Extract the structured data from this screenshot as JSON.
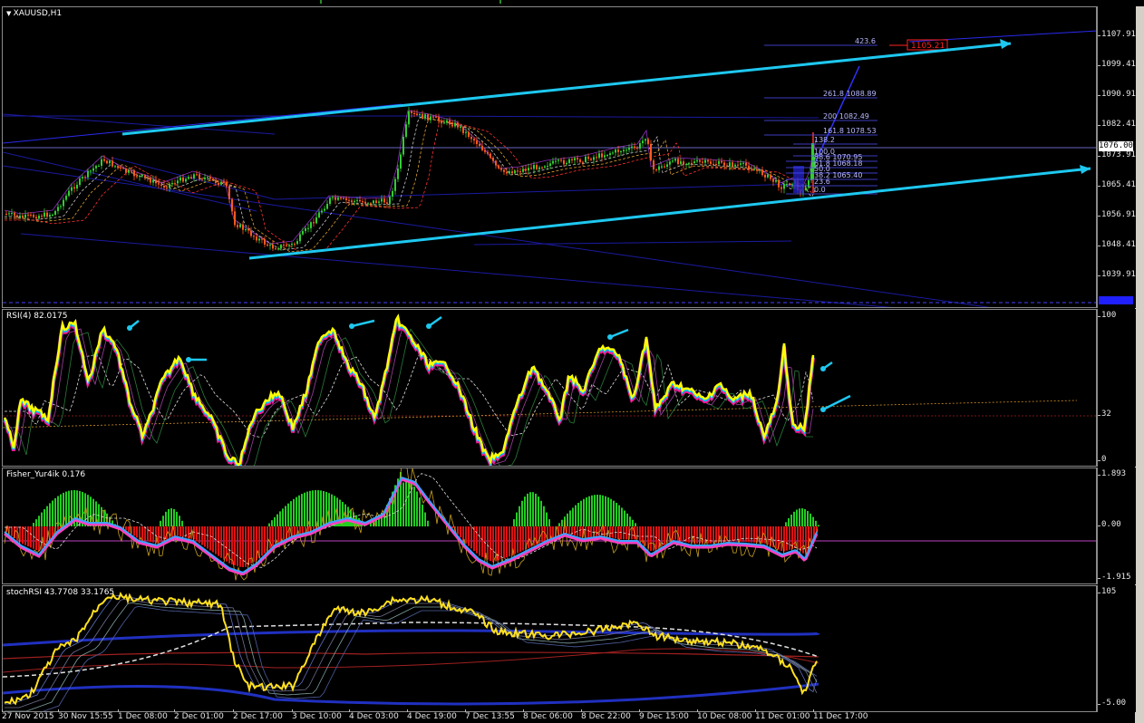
{
  "window": {
    "title": "XAUUSD,H1"
  },
  "main_chart": {
    "symbol_label": "XAUUSD,H1",
    "price_ticks": [
      "1107.91",
      "1099.41",
      "1090.91",
      "1082.41",
      "1073.91",
      "1065.41",
      "1056.91",
      "1048.41",
      "1039.91"
    ],
    "current_price": "1076.00",
    "target_label": "1105.21",
    "fib_levels": [
      "423.6",
      "261.8 1088.89",
      "200 1082.49",
      "161.8 1078.53",
      "138.2",
      "100.0",
      "88.6 1070.95",
      "61.8 1068.18",
      "50.0",
      "38.2 1065.40",
      "23.6",
      "0.0"
    ]
  },
  "rsi_panel": {
    "label": "RSI(4) 82.0175",
    "ticks": [
      "100",
      "32",
      "0"
    ]
  },
  "fisher_panel": {
    "label": "Fisher_Yur4ik 0.176",
    "ticks": [
      "1.893",
      "0.00",
      "-1.915"
    ]
  },
  "stoch_panel": {
    "label": "stochRSI 43.7708 33.1765",
    "ticks": [
      "105",
      "-5.00"
    ]
  },
  "time_axis": [
    "27 Nov 2015",
    "30 Nov 15:55",
    "1 Dec 08:00",
    "2 Dec 01:00",
    "2 Dec 17:00",
    "3 Dec 10:00",
    "4 Dec 03:00",
    "4 Dec 19:00",
    "7 Dec 13:55",
    "8 Dec 06:00",
    "8 Dec 22:00",
    "9 Dec 15:00",
    "10 Dec 08:00",
    "11 Dec 01:00",
    "11 Dec 17:00"
  ],
  "colors": {
    "bull_candle": "#32cd32",
    "bear_candle": "#ff5a1e",
    "channel_line": "#1ec8f0",
    "grid_line": "#1a1aa0",
    "rsi_yellow": "#ffff00",
    "rsi_magenta": "#ff1493",
    "rsi_cyan": "#00bfff",
    "hist_up": "#22cc22",
    "hist_down": "#dd1111",
    "target_box": "#ff2020"
  }
}
